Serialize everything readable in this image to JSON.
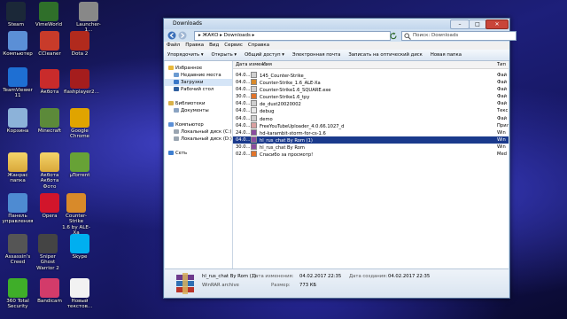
{
  "desktop": {
    "icons": [
      {
        "label": "Steam",
        "color": "#1b2838"
      },
      {
        "label": "VimeWorld",
        "color": "#2f6f2a"
      },
      {
        "label": "Launcher-1...",
        "color": "#888888"
      },
      {
        "label": "Компьютер",
        "color": "#5b8fd6"
      },
      {
        "label": "CCleaner",
        "color": "#c83b2a"
      },
      {
        "label": "Dota 2",
        "color": "#b12a1d"
      },
      {
        "label": "TeamViewer\n11",
        "color": "#1e6fd3"
      },
      {
        "label": "Акбота",
        "color": "#c92b2b"
      },
      {
        "label": "flashplayer2...",
        "color": "#a51d1d"
      },
      {
        "label": "Корзина",
        "color": "#8cb2d9"
      },
      {
        "label": "Minecraft",
        "color": "#5c8a3a"
      },
      {
        "label": "Google\nChrome",
        "color": "#e0a400"
      },
      {
        "label": "Жанрас\nпапка",
        "color": "#e8c25a"
      },
      {
        "label": "Акбота Акбота\nФото",
        "color": "#e8c25a"
      },
      {
        "label": "μTorrent",
        "color": "#67a236"
      },
      {
        "label": "Панель\nуправления",
        "color": "#4e8bd2"
      },
      {
        "label": "Opera",
        "color": "#d2152b"
      },
      {
        "label": "Counter-Strike\n1.6 by ALE-Xa",
        "color": "#d88a2a"
      },
      {
        "label": "Assassin's\nCreed",
        "color": "#555555"
      },
      {
        "label": "Sniper Ghost\nWarrior 2",
        "color": "#444444"
      },
      {
        "label": "Skype",
        "color": "#00aff0"
      },
      {
        "label": "360 Total\nSecurity",
        "color": "#3fae29"
      },
      {
        "label": "Bandicam",
        "color": "#d33b6a"
      },
      {
        "label": "Новый\nтекстов...",
        "color": "#f2f2f2"
      }
    ]
  },
  "window": {
    "title": "Downloads",
    "controls": {
      "minimize": "–",
      "maximize": "□",
      "close": "✕"
    },
    "address": "▸ ЖАКО ▸ Downloads ▸",
    "search_placeholder": "Поиск: Downloads",
    "menu": [
      "Файл",
      "Правка",
      "Вид",
      "Сервис",
      "Справка"
    ],
    "toolbar": [
      "Упорядочить ▾",
      "Открыть ▾",
      "Общий доступ ▾",
      "Электронная почта",
      "Записать на оптический диск",
      "Новая папка"
    ],
    "nav": [
      {
        "label": "Избранное",
        "color": "#e8b83a",
        "indent": 0
      },
      {
        "label": "Недавние места",
        "color": "#6b9bd1",
        "indent": 1
      },
      {
        "label": "Загрузки",
        "color": "#3a78c8",
        "indent": 1,
        "selected": true
      },
      {
        "label": "Рабочий стол",
        "color": "#2f5f9f",
        "indent": 1
      },
      {
        "label": "",
        "color": "",
        "indent": 0
      },
      {
        "label": "Библиотеки",
        "color": "#d9b24a",
        "indent": 0
      },
      {
        "label": "Документы",
        "color": "#8aa3c2",
        "indent": 1
      },
      {
        "label": "",
        "color": "",
        "indent": 0
      },
      {
        "label": "Компьютер",
        "color": "#5b8fd6",
        "indent": 0
      },
      {
        "label": "Локальный диск (C:)",
        "color": "#9aa5b1",
        "indent": 1
      },
      {
        "label": "Локальный диск (D:)",
        "color": "#9aa5b1",
        "indent": 1
      },
      {
        "label": "",
        "color": "",
        "indent": 0
      },
      {
        "label": "Сеть",
        "color": "#3e7fd0",
        "indent": 0
      }
    ],
    "columns": {
      "date": "Дата измен...",
      "name": "Имя",
      "type": "Тип"
    },
    "files": [
      {
        "date": "04.0...",
        "name": "145_Counter-Strike_",
        "type": "Фай",
        "color": "#cfcfcf"
      },
      {
        "date": "04.0...",
        "name": "Counter-Strike_1.6_ALE-Xa",
        "type": "Фай",
        "color": "#d88a2a"
      },
      {
        "date": "04.0...",
        "name": "Counter-Strike1.6_SQUARE.exe",
        "type": "Фай",
        "color": "#cfcfcf"
      },
      {
        "date": "30.0...",
        "name": "Counter-Strike1.6_tpy",
        "type": "Фай",
        "color": "#e2742a"
      },
      {
        "date": "04.0...",
        "name": "de_dust20020002",
        "type": "Фай",
        "color": "#cfcfcf"
      },
      {
        "date": "04.0...",
        "name": "debug",
        "type": "Текс",
        "color": "#e8e8e8"
      },
      {
        "date": "04.0...",
        "name": "demo",
        "type": "Фай",
        "color": "#cfcfcf"
      },
      {
        "date": "04.0...",
        "name": "FreeYouTubeUploader_4.0.66.1027_d",
        "type": "Прил",
        "color": "#d9a0a0"
      },
      {
        "date": "24.0...",
        "name": "hd-karambit-storm-for-cs-1.6",
        "type": "Win",
        "color": "#8a4ca0"
      },
      {
        "date": "04.0...",
        "name": "hl_rus_chat By Rom (1)",
        "type": "Win",
        "color": "#8a4ca0",
        "selected": true
      },
      {
        "date": "30.0...",
        "name": "hl_rus_chat By Rom",
        "type": "Win",
        "color": "#8a4ca0"
      },
      {
        "date": "02.0...",
        "name": "Спасибо за просмотр!",
        "type": "Med",
        "color": "#e2742a"
      }
    ],
    "details": {
      "filename": "hl_rus_chat By Rom (1)",
      "filetype": "WinRAR archive",
      "modified_label": "Дата изменения:",
      "modified": "04.02.2017 22:35",
      "size_label": "Размер:",
      "size": "773 КБ",
      "created_label": "Дата создания:",
      "created": "04.02.2017 22:35"
    }
  }
}
